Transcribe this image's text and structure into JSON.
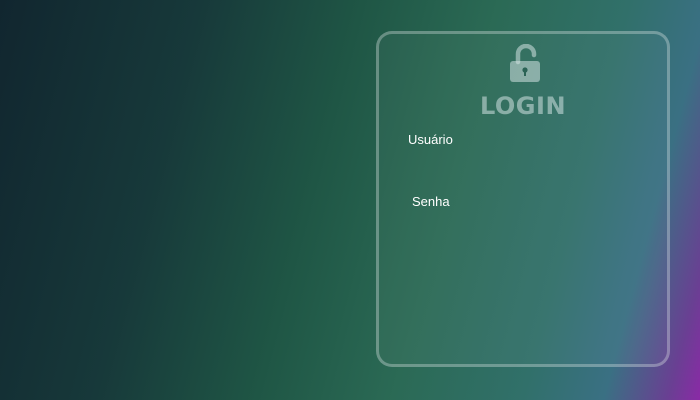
{
  "login": {
    "title": "LOGIN",
    "lock_icon": "unlocked-padlock-icon",
    "username_label": "Usuário",
    "username_value": "",
    "password_label": "Senha",
    "password_value": ""
  },
  "colors": {
    "card_border": "#dce6e6",
    "title": "#d2e1e1",
    "label": "#ffffff",
    "background_start": "#11262f",
    "background_mid": "#2b6a55",
    "background_end": "#8a2aa6"
  }
}
